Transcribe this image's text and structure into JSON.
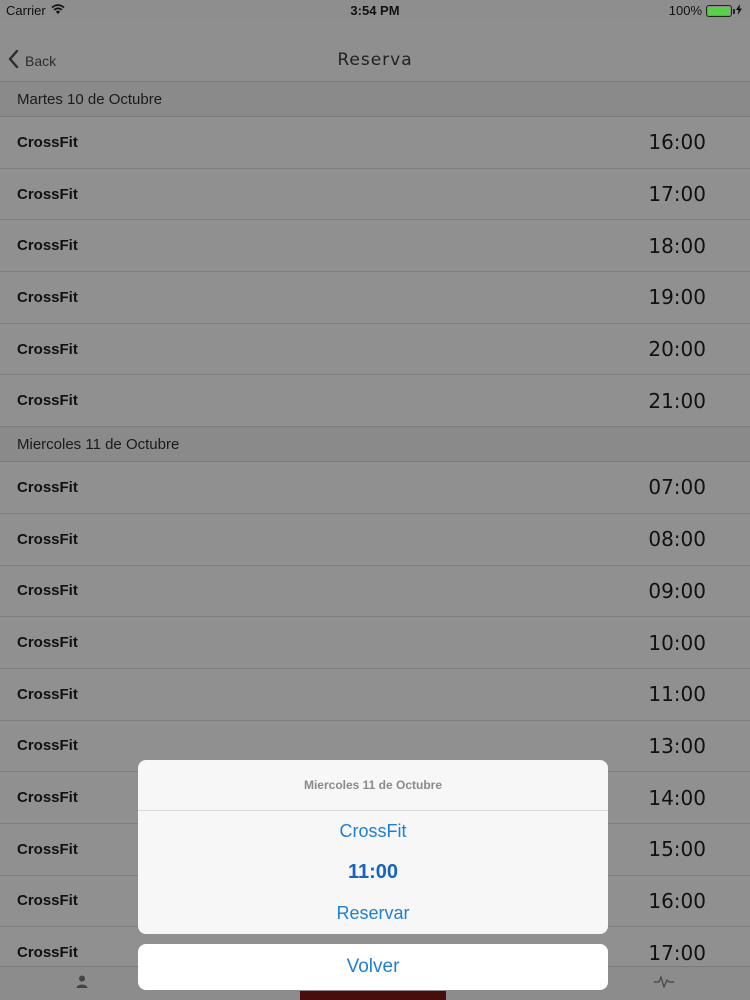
{
  "status_bar": {
    "carrier": "Carrier",
    "time": "3:54 PM",
    "battery": "100%"
  },
  "nav": {
    "back_label": "Back",
    "title": "Reserva"
  },
  "sections": [
    {
      "header": "Martes 10 de Octubre",
      "rows": [
        {
          "name": "CrossFit",
          "time": "16:00"
        },
        {
          "name": "CrossFit",
          "time": "17:00"
        },
        {
          "name": "CrossFit",
          "time": "18:00"
        },
        {
          "name": "CrossFit",
          "time": "19:00"
        },
        {
          "name": "CrossFit",
          "time": "20:00"
        },
        {
          "name": "CrossFit",
          "time": "21:00"
        }
      ]
    },
    {
      "header": "Miercoles 11 de Octubre",
      "rows": [
        {
          "name": "CrossFit",
          "time": "07:00"
        },
        {
          "name": "CrossFit",
          "time": "08:00"
        },
        {
          "name": "CrossFit",
          "time": "09:00"
        },
        {
          "name": "CrossFit",
          "time": "10:00"
        },
        {
          "name": "CrossFit",
          "time": "11:00"
        },
        {
          "name": "CrossFit",
          "time": "13:00"
        },
        {
          "name": "CrossFit",
          "time": "14:00"
        },
        {
          "name": "CrossFit",
          "time": "15:00"
        },
        {
          "name": "CrossFit",
          "time": "16:00"
        },
        {
          "name": "CrossFit",
          "time": "17:00"
        }
      ]
    }
  ],
  "action_sheet": {
    "title": "Miercoles 11 de Octubre",
    "class_name": "CrossFit",
    "time": "11:00",
    "reserve_label": "Reservar",
    "cancel_label": "Volver"
  },
  "tabbar": {
    "icons": [
      "person-icon",
      "activity-icon"
    ]
  },
  "colors": {
    "accent": "#1e7fd6",
    "tab_active": "#4a0d0d",
    "battery": "#55d246"
  }
}
